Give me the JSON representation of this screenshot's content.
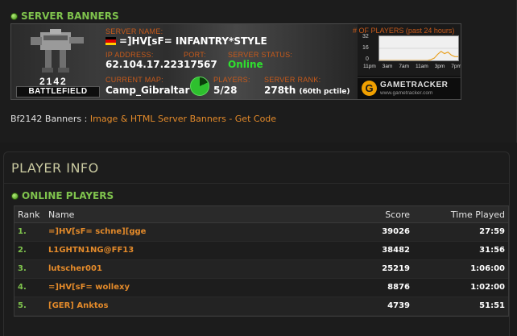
{
  "server_banners": {
    "heading": "SERVER BANNERS",
    "banner": {
      "game_year": "2142",
      "game_name": "BATTLEFIELD",
      "labels": {
        "server_name": "SERVER NAME:",
        "ip_address": "IP ADDRESS:",
        "port": "PORT:",
        "server_status": "SERVER STATUS:",
        "current_map": "CURRENT MAP:",
        "players": "PLAYERS:",
        "server_rank": "SERVER RANK:"
      },
      "server_name": "=]HV[sF= INFANTRY*STYLE",
      "ip_address": "62.104.17.223",
      "port": "17567",
      "status": "Online",
      "current_map": "Camp_Gibraltar",
      "players": "5/28",
      "players_fraction": 0.18,
      "rank": "278th",
      "rank_suffix": "(60th pctile)",
      "graph": {
        "title": "# OF PLAYERS (past 24 hours)",
        "y_ticks": [
          "32",
          "16",
          "0"
        ],
        "x_ticks": [
          "11pm",
          "3am",
          "7am",
          "11am",
          "3pm",
          "7pm"
        ],
        "series": [
          0,
          0,
          0,
          0,
          0,
          0,
          0,
          0,
          0,
          0,
          0,
          0,
          0,
          0,
          0,
          1,
          3,
          8,
          12,
          9,
          11,
          7,
          5,
          5
        ]
      },
      "gametracker_name": "GAMETRACKER",
      "gametracker_url": "www.gametracker.com"
    },
    "code_prefix": "Bf2142 Banners : ",
    "code_link": "Image & HTML Server Banners - Get Code"
  },
  "player_info": {
    "title": "PLAYER INFO",
    "online_heading": "ONLINE PLAYERS",
    "columns": {
      "rank": "Rank",
      "name": "Name",
      "score": "Score",
      "time": "Time Played"
    },
    "rows": [
      {
        "rank": "1.",
        "name": "=]HV[sF= schne][gge",
        "score": "39026",
        "time": "27:59"
      },
      {
        "rank": "2.",
        "name": "L1GHTN1NG@FF13",
        "score": "38482",
        "time": "31:56"
      },
      {
        "rank": "3.",
        "name": "lutscher001",
        "score": "25219",
        "time": "1:06:00"
      },
      {
        "rank": "4.",
        "name": "=]HV[sF= wollexy",
        "score": "8876",
        "time": "1:02:00"
      },
      {
        "rank": "5.",
        "name": "[GER] Anktos",
        "score": "4739",
        "time": "51:51"
      }
    ]
  },
  "colors": {
    "accent_green": "#7fc34d",
    "link_orange": "#e38a2a",
    "label_orange": "#c85a1a",
    "online_green": "#2fe02f",
    "background": "#1a1a1a"
  }
}
